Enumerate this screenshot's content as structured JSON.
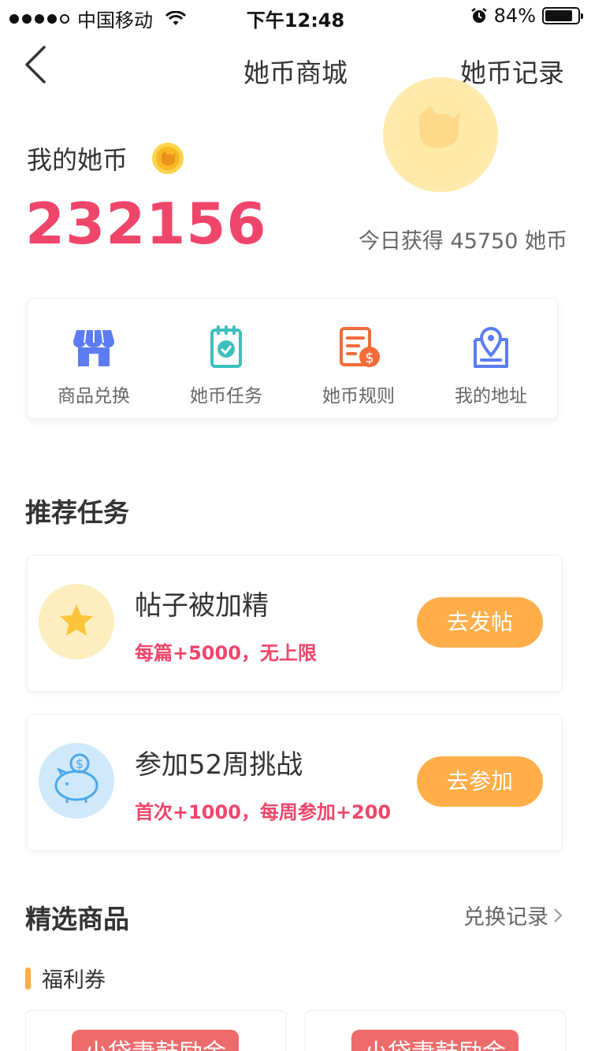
{
  "status_bar": {
    "carrier": "中国移动",
    "time": "下午12:48",
    "battery_percent": "84%",
    "battery_level": 0.84,
    "signal_icon": "signal-dots-icon",
    "wifi_icon": "wifi-icon",
    "alarm_icon": "alarm-icon"
  },
  "nav": {
    "back_icon": "chevron-left-icon",
    "title": "她币商城",
    "right_link": "她币记录"
  },
  "balance": {
    "label": "我的她币",
    "value": "232156",
    "today_earned": "今日获得 45750 她币",
    "coin_icon": "coin-icon"
  },
  "shortcuts": [
    {
      "label": "商品兑换",
      "icon": "store-icon",
      "color": "#5b7cf2"
    },
    {
      "label": "她币任务",
      "icon": "task-clipboard-icon",
      "color": "#3dbfbd"
    },
    {
      "label": "她币规则",
      "icon": "rules-document-icon",
      "color": "#f26b3a"
    },
    {
      "label": "我的地址",
      "icon": "location-pin-icon",
      "color": "#5b7cf2"
    }
  ],
  "recommended": {
    "title": "推荐任务",
    "tasks": [
      {
        "title": "帖子被加精",
        "desc": "每篇+5000，无上限",
        "button": "去发帖",
        "icon": "star-icon",
        "icon_bg": "#fdeec0"
      },
      {
        "title": "参加52周挑战",
        "desc": "首次+1000，每周参加+200",
        "button": "去参加",
        "icon": "piggy-bank-icon",
        "icon_bg": "#cfe9fb"
      }
    ]
  },
  "featured": {
    "title": "精选商品",
    "record_link": "兑换记录",
    "sub_tab": "福利券",
    "products": [
      {
        "banner": "小袋妻鼓励金"
      },
      {
        "banner": "小袋妻鼓励金"
      }
    ]
  },
  "colors": {
    "accent_red": "#f0456a",
    "button_orange": "#ffae4a"
  }
}
